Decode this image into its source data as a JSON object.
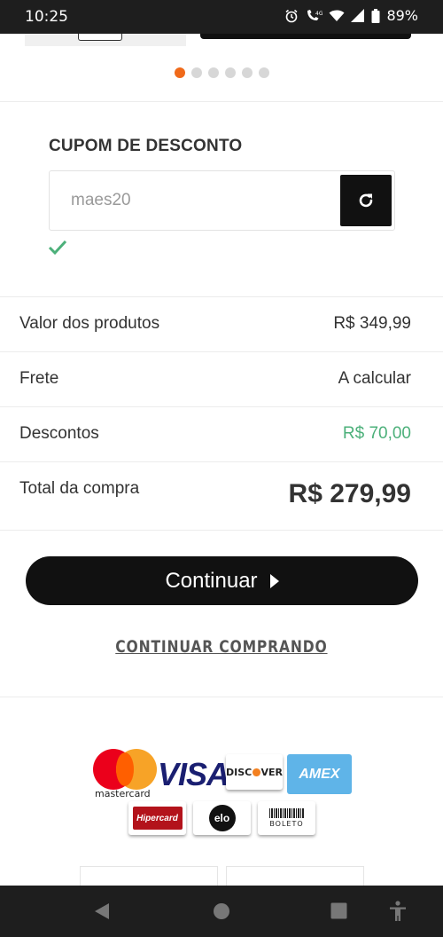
{
  "status_bar": {
    "time": "10:25",
    "battery": "89%",
    "icons": [
      "alarm-icon",
      "volte-call-icon",
      "wifi-icon",
      "signal-icon",
      "battery-icon"
    ]
  },
  "carousel": {
    "dot_count": 6,
    "active_index": 0,
    "active_color": "#f06a1a"
  },
  "coupon": {
    "title": "CUPOM DE DESCONTO",
    "value": "maes20",
    "applied": true,
    "refresh_icon": "refresh-icon"
  },
  "summary": {
    "products_label": "Valor dos produtos",
    "products_value": "R$ 349,99",
    "shipping_label": "Frete",
    "shipping_value": "A calcular",
    "discount_label": "Descontos",
    "discount_value": "R$ 70,00",
    "total_label": "Total da compra",
    "total_value": "R$ 279,99",
    "discount_color": "#4cb07a"
  },
  "actions": {
    "continue_label": "Continuar",
    "continue_shopping_label": "CONTINUAR COMPRANDO"
  },
  "payments": {
    "mastercard": "mastercard",
    "visa": "VISA",
    "discover_left": "DISC",
    "discover_right": "VER",
    "amex": "AMEX",
    "hipercard": "Hipercard",
    "elo": "elo",
    "boleto": "BOLETO"
  },
  "navigation": {
    "icons": [
      "back-icon",
      "home-icon",
      "recents-icon",
      "accessibility-icon"
    ]
  }
}
